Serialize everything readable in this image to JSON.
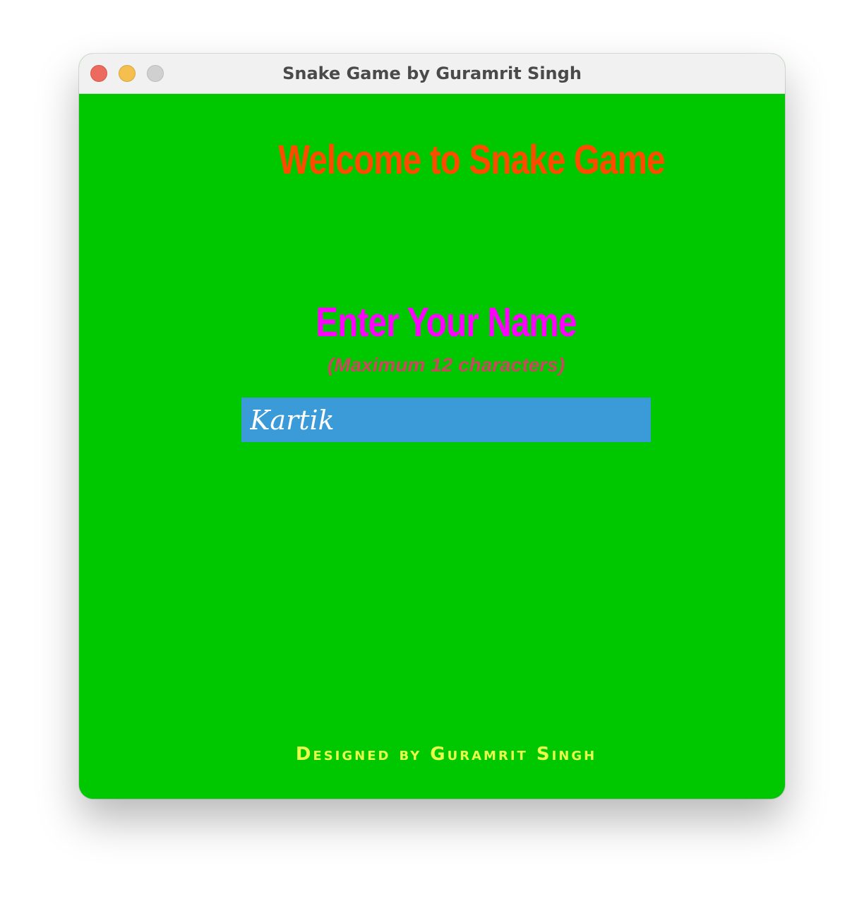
{
  "window": {
    "title": "Snake Game by Guramrit Singh"
  },
  "game": {
    "welcome": "Welcome to Snake Game",
    "prompt": "Enter Your Name",
    "hint": "(Maximum 12 characters)",
    "name_value": "Kartik",
    "footer": "Designed by Guramrit Singh"
  },
  "colors": {
    "background": "#00c800",
    "welcome": "#ff4b00",
    "prompt": "#ff00ff",
    "hint": "#c9485e",
    "input_bg": "#3a9bd8",
    "input_text": "#ffffff",
    "footer": "#e8ff4a"
  }
}
